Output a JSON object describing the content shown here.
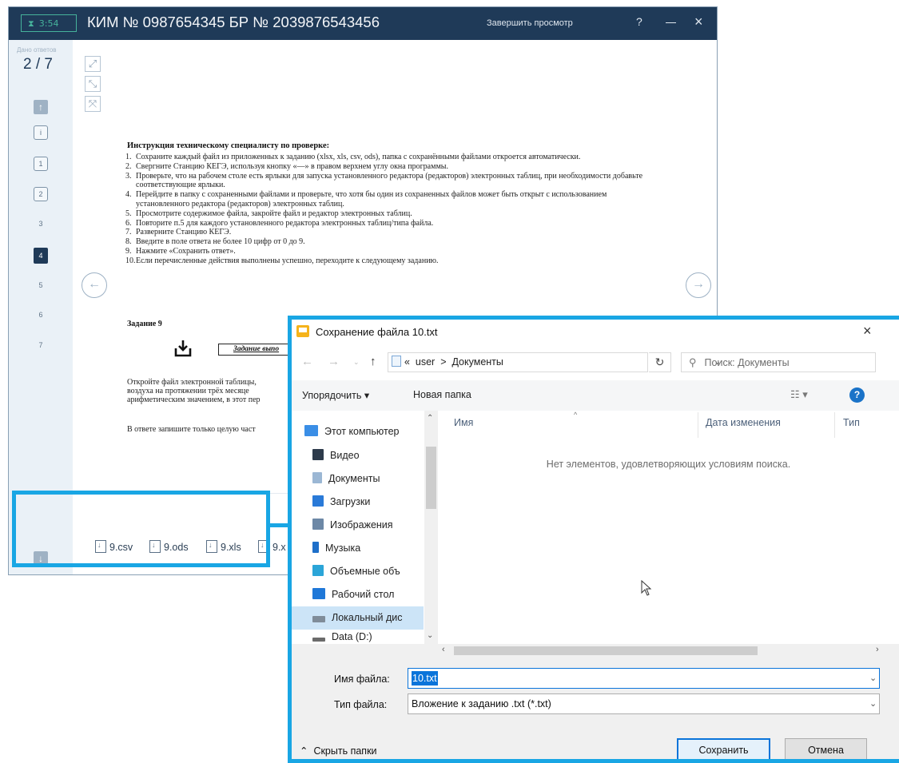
{
  "exam_window": {
    "timer": "3:54",
    "title": "КИМ № 0987654345   БР № 2039876543456",
    "finish_link": "Завершить просмотр",
    "help": "?",
    "answers_label": "Дано ответов",
    "progress": "2 / 7",
    "sidebar_buttons": [
      "i",
      "1",
      "2"
    ],
    "task_numbers": [
      "3",
      "4",
      "5",
      "6",
      "7"
    ],
    "active_task": "4",
    "instruction_title": "Инструкция техническому специалисту по проверке:",
    "instructions": [
      {
        "n": "1.",
        "text": "Сохраните каждый файл из приложенных к заданию (xlsx, xls, csv, ods), папка с сохранёнными файлами откроется автоматически."
      },
      {
        "n": "2.",
        "text": "Свергните Станцию КЕГЭ, используя кнопку «—» в правом верхнем углу окна программы."
      },
      {
        "n": "3.",
        "text": "Проверьте, что на рабочем столе есть ярлыки для запуска установленного редактора (редакторов) электронных таблиц, при необходимости добавьте соответствующие ярлыки."
      },
      {
        "n": "4.",
        "text": "Перейдите в папку с сохраненными файлами и проверьте, что хотя бы один из сохраненных файлов может быть открыт с использованием установленного редактора (редакторов) электронных таблиц."
      },
      {
        "n": "5.",
        "text": "Просмотрите содержимое файла, закройте файл и редактор электронных таблиц."
      },
      {
        "n": "6.",
        "text": "Повторите п.5 для каждого установленного редактора электронных таблиц/типа файла."
      },
      {
        "n": "7.",
        "text": "Разверните Станцию КЕГЭ."
      },
      {
        "n": "8.",
        "text": "Введите в поле ответа не более 10 цифр от 0 до 9."
      },
      {
        "n": "9.",
        "text": "Нажмите «Сохранить ответ»."
      },
      {
        "n": "10.",
        "text": "Если перечисленные действия выполнены успешно, переходите к следующему заданию."
      }
    ],
    "task_title": "Задание 9",
    "task_attachment": "Задание выпо",
    "task_text_lines": [
      "Откройте файл электронной таблицы,",
      "воздуха на протяжении трёх месяце",
      "арифметическим значением, в этот пер"
    ],
    "task_answer_line": "В ответе запишите только целую част",
    "files": [
      "9.csv",
      "9.ods",
      "9.xls",
      "9.x"
    ]
  },
  "save_dialog": {
    "title": "Сохранение файла 10.txt",
    "path_prefix": "«",
    "path_user": "user",
    "path_sep": ">",
    "path_folder": "Документы",
    "search_placeholder": "Поиск: Документы",
    "organize_label": "Упорядочить ▾",
    "new_folder_label": "Новая папка",
    "nav_items": [
      {
        "label": "Этот компьютер",
        "icon": "computer-icon",
        "color": "#3a8ee6"
      },
      {
        "label": "Видео",
        "icon": "video-icon",
        "color": "#2d3b4b"
      },
      {
        "label": "Документы",
        "icon": "documents-icon",
        "color": "#9bb7d4"
      },
      {
        "label": "Загрузки",
        "icon": "downloads-icon",
        "color": "#2a7ad8"
      },
      {
        "label": "Изображения",
        "icon": "images-icon",
        "color": "#6d88a6"
      },
      {
        "label": "Музыка",
        "icon": "music-icon",
        "color": "#1e6fc9"
      },
      {
        "label": "Объемные объ",
        "icon": "3d-objects-icon",
        "color": "#2ba5d8"
      },
      {
        "label": "Рабочий стол",
        "icon": "desktop-icon",
        "color": "#1f78d8"
      },
      {
        "label": "Локальный дис",
        "icon": "local-disk-icon",
        "color": "#7f8c99"
      },
      {
        "label": "Data (D:)",
        "icon": "drive-icon",
        "color": "#6b6b6b"
      }
    ],
    "columns": [
      "Имя",
      "Дата изменения",
      "Тип"
    ],
    "empty_message": "Нет элементов, удовлетворяющих условиям поиска.",
    "filename_label": "Имя файла:",
    "filename_value": "10.txt",
    "filetype_label": "Тип файла:",
    "filetype_value": "Вложение к заданию .txt (*.txt)",
    "hide_folders_label": "Скрыть папки",
    "save_label": "Сохранить",
    "cancel_label": "Отмена"
  },
  "colors": {
    "titlebar": "#1f3a58",
    "highlight": "#19a6e4",
    "accent": "#0a74da"
  }
}
